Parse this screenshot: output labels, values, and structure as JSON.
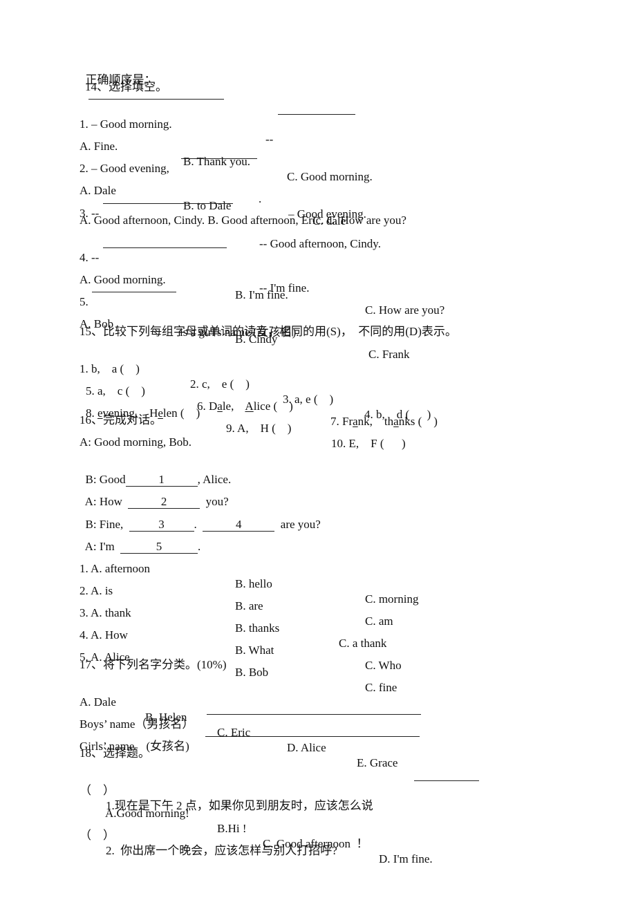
{
  "top": {
    "label": "正确顺序是："
  },
  "q14": {
    "title": "14、选择填空。",
    "items": [
      {
        "prompt": "1. – Good morning.",
        "reply": "--",
        "options": [
          "A. Fine.",
          "B. Thank you.",
          "C. Good morning."
        ]
      },
      {
        "prompt": "2. – Good evening,",
        "prompt_end": ".",
        "reply": "– Good evening.",
        "options": [
          "A. Dale",
          "B. to Dale",
          "C. dale"
        ]
      },
      {
        "prompt": "3. --",
        "reply": "-- Good afternoon, Cindy.",
        "options_line": "A. Good afternoon, Cindy. B. Good afternoon, Eric. C. How are you?"
      },
      {
        "prompt": "4. --",
        "reply": "-- I'm fine.",
        "options": [
          "A. Good morning.",
          "B. I'm fine.",
          "C. How are you?"
        ]
      },
      {
        "prompt": "5.",
        "reply": "is a girl's name (女孩名).",
        "options": [
          "A. Bob",
          "B. Cindy",
          "C. Frank"
        ]
      }
    ]
  },
  "q15": {
    "title": "15、比较下列每组字母或单词的读音，相同的用(S)，  不同的用(D)表示。",
    "row1": [
      "1. b,    a (    )",
      "2. c,    e (    )",
      "3. a, e (    )",
      "4. b,    d (      )"
    ],
    "row2": {
      "i5": "5. a,    c (    )",
      "i6a": "6. D",
      "i6b": "a",
      "i6c": "le,    ",
      "i6d": "A",
      "i6e": "lice (    )",
      "i7a": "7. Fr",
      "i7b": "a",
      "i7c": "nk,    th",
      "i7d": "a",
      "i7e": "nks (    )"
    },
    "row3": {
      "i8a": "8. ",
      "i8b": "e",
      "i8c": "vening,    H",
      "i8d": "e",
      "i8e": "len (    )",
      "i9": "9. A,    H (    )",
      "i10": "10. E,    F (      )"
    }
  },
  "q16": {
    "title": "16、完成对话。",
    "dialog": [
      {
        "pre": "A: Good morning, Bob."
      },
      {
        "pre": "B: Good",
        "blank": "1",
        "post": ", Alice."
      },
      {
        "pre": "A: How ",
        "blank": "2",
        "post": "  you?"
      },
      {
        "pre": "B: Fine, ",
        "blank": "3",
        "mid": ".  ",
        "blank2": "4",
        "post": "  are you?"
      },
      {
        "pre": "A: I'm ",
        "blank": "5",
        "post": "."
      }
    ],
    "choices": [
      [
        "1. A. afternoon",
        "B. hello",
        "C. morning"
      ],
      [
        "2. A. is",
        "B. are",
        "C. am"
      ],
      [
        "3. A. thank",
        "B. thanks",
        "C. a thank"
      ],
      [
        "4. A. How",
        "B. What",
        "C. Who"
      ],
      [
        "5. A. Alice",
        "B. Bob",
        "C. fine"
      ]
    ]
  },
  "q17": {
    "title": "17、将下列名字分类。(10%)",
    "names": [
      "A. Dale",
      "B. Helen",
      "C. Eric",
      "D. Alice",
      "E. Grace"
    ],
    "boys_label": "Boys’ name（男孩名）",
    "girls_label": "Girls’ name    (女孩名)"
  },
  "q18": {
    "title": "18、选择题。",
    "items": [
      {
        "paren": "（    ）",
        "text": "1.现在是下午 2 点，如果你见到朋友时，应该怎么说",
        "options": [
          "A.Good morning!",
          "B.Hi !",
          "C. Good afternoon  ！",
          "D. I'm fine."
        ]
      },
      {
        "paren": "（    ）",
        "text": "2.  你出席一个晚会，应该怎样与别人打招呼?"
      }
    ]
  }
}
